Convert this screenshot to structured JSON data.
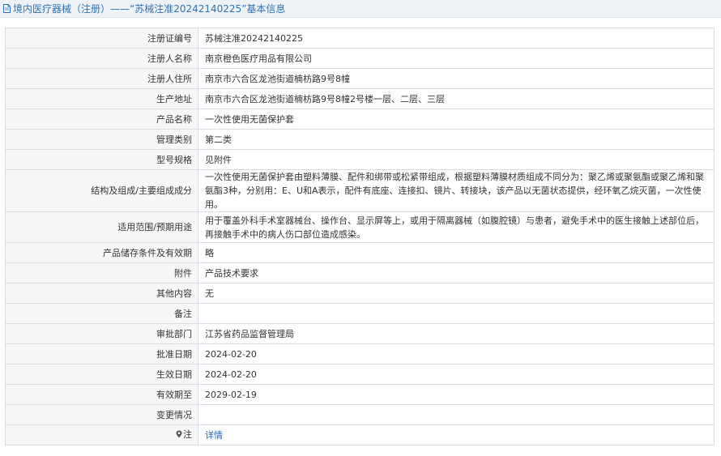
{
  "header": {
    "title": "境内医疗器械（注册）——“苏械注准20242140225”基本信息"
  },
  "rows": [
    {
      "label": "注册证编号",
      "value": "苏械注准20242140225"
    },
    {
      "label": "注册人名称",
      "value": "南京橙色医疗用品有限公司"
    },
    {
      "label": "注册人住所",
      "value": "南京市六合区龙池街道楠枋路9号8幢"
    },
    {
      "label": "生产地址",
      "value": "南京市六合区龙池街道楠枋路9号8幢2号楼一层、二层、三层"
    },
    {
      "label": "产品名称",
      "value": "一次性使用无菌保护套"
    },
    {
      "label": "管理类别",
      "value": "第二类"
    },
    {
      "label": "型号规格",
      "value": "见附件"
    },
    {
      "label": "结构及组成/主要组成成分",
      "value": "一次性使用无菌保护套由塑料薄膜、配件和绑带或松紧带组成，根据塑料薄膜材质组成不同分为：聚乙烯或聚氨酯或聚乙烯和聚氨酯3种，分别用：E、U和A表示，配件有底座、连接扣、镜片、转接块，该产品以无菌状态提供，经环氧乙烷灭菌，一次性使用。"
    },
    {
      "label": "适用范围/预期用途",
      "value": "用于覆盖外科手术室器械台、操作台、显示屏等上，或用于隔离器械（如腹腔镜）与患者，避免手术中的医生接触上述部位后，再接触手术中的病人伤口部位造成感染。"
    },
    {
      "label": "产品储存条件及有效期",
      "value": "略"
    },
    {
      "label": "附件",
      "value": "产品技术要求"
    },
    {
      "label": "其他内容",
      "value": "无"
    },
    {
      "label": "备注",
      "value": ""
    },
    {
      "label": "审批部门",
      "value": "江苏省药品监督管理局"
    },
    {
      "label": "批准日期",
      "value": "2024-02-20"
    },
    {
      "label": "生效日期",
      "value": "2024-02-20"
    },
    {
      "label": "有效期至",
      "value": "2029-02-19"
    },
    {
      "label": "变更情况",
      "value": ""
    }
  ],
  "note_row": {
    "label": "注",
    "icon": "map-pin-icon",
    "link_text": "详情"
  },
  "colors": {
    "title": "#3070b0",
    "link": "#2a64b4",
    "label_bg": "#f7f7f7",
    "border": "#d6dde4",
    "title_bar_bg": "#eef3f8"
  }
}
